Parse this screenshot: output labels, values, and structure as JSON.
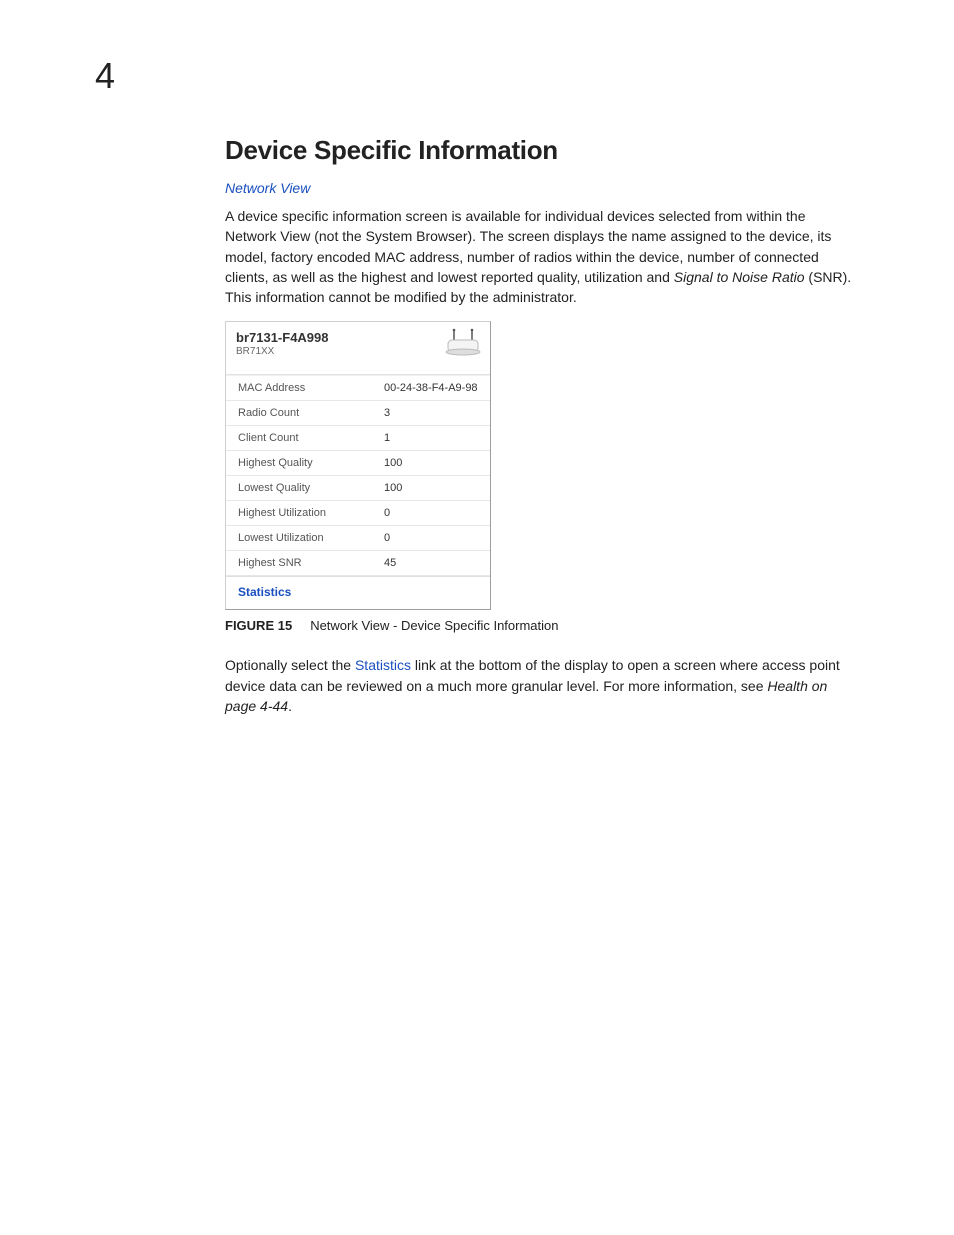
{
  "chapter_number": "4",
  "heading": "Device Specific Information",
  "subsection_link": "Network View",
  "intro_paragraph_parts": {
    "p1": "A device specific information screen is available for individual devices selected from within the Network View (not the System Browser). The screen displays the name assigned to the device, its model, factory encoded MAC address, number of radios within the device, number of connected clients, as well as the highest and lowest reported quality, utilization and ",
    "snr_italic": "Signal to Noise Ratio",
    "p2": " (SNR). This information cannot be modified by the administrator."
  },
  "device_panel": {
    "name": "br7131-F4A998",
    "model": "BR71XX",
    "rows": [
      {
        "label": "MAC Address",
        "value": "00-24-38-F4-A9-98"
      },
      {
        "label": "Radio Count",
        "value": "3"
      },
      {
        "label": "Client Count",
        "value": "1"
      },
      {
        "label": "Highest Quality",
        "value": "100"
      },
      {
        "label": "Lowest Quality",
        "value": "100"
      },
      {
        "label": "Highest Utilization",
        "value": "0"
      },
      {
        "label": "Lowest Utilization",
        "value": "0"
      },
      {
        "label": "Highest SNR",
        "value": "45"
      }
    ],
    "footer_link": "Statistics"
  },
  "figure": {
    "label": "FIGURE 15",
    "caption": "Network View - Device Specific Information"
  },
  "closing_paragraph_parts": {
    "p1": "Optionally select the ",
    "link": "Statistics",
    "p2": " link at the bottom of the display to open a screen where access point device data can be reviewed on a much more granular level. For more information, see ",
    "italic": "Health on page 4-44",
    "p3": "."
  }
}
